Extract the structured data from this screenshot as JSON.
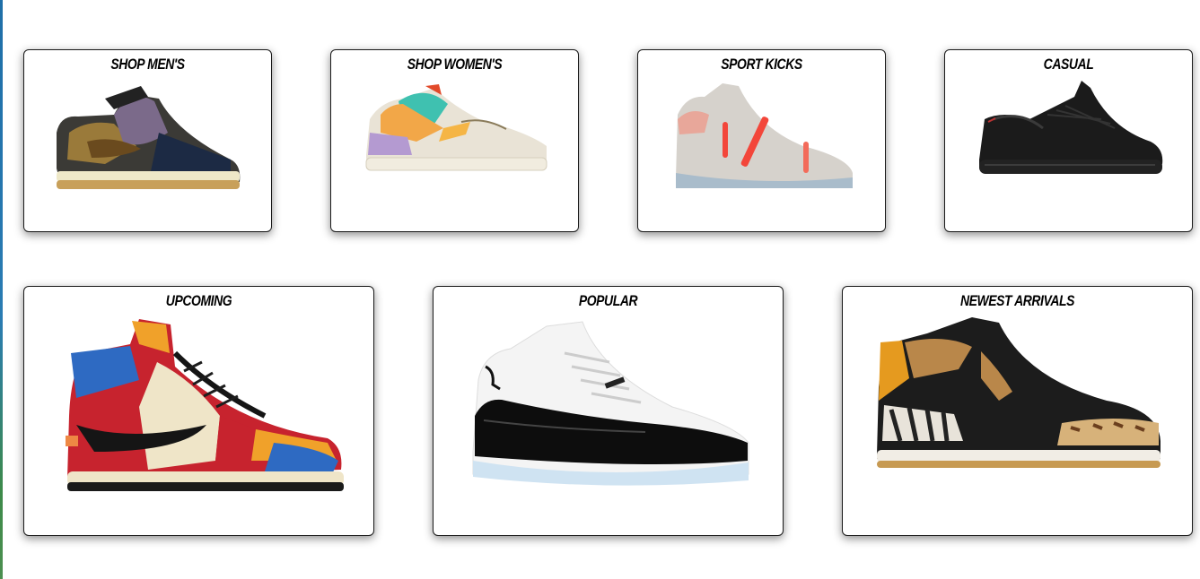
{
  "categories": {
    "row1": [
      {
        "title": "SHOP MEN'S",
        "icon": "sneaker-low-brown-icon"
      },
      {
        "title": "SHOP WOMEN'S",
        "icon": "sneaker-pastel-icon"
      },
      {
        "title": "SPORT KICKS",
        "icon": "sneaker-grey-sport-icon"
      },
      {
        "title": "CASUAL",
        "icon": "sneaker-black-knit-icon"
      }
    ],
    "row2": [
      {
        "title": "UPCOMING",
        "icon": "sneaker-high-multicolor-icon"
      },
      {
        "title": "POPULAR",
        "icon": "sneaker-patent-white-black-icon"
      },
      {
        "title": "NEWEST ARRIVALS",
        "icon": "sneaker-animal-print-icon"
      }
    ]
  }
}
